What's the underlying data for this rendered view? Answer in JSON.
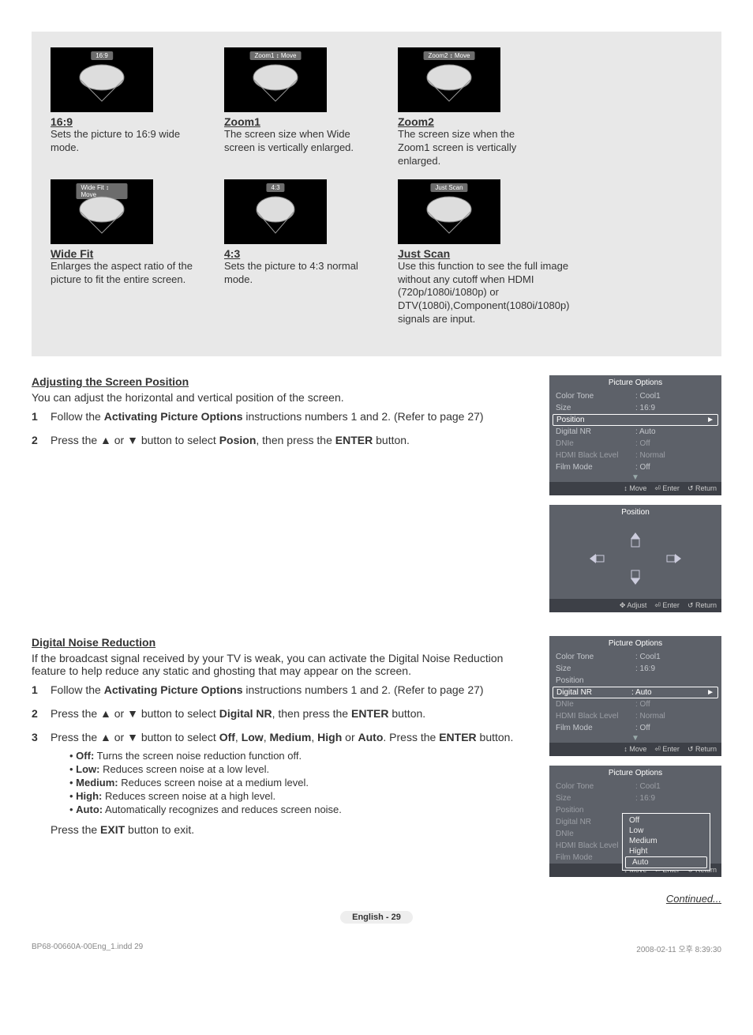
{
  "sizes": {
    "r1": [
      {
        "banner": "16:9",
        "title": "16:9",
        "desc": "Sets the picture to 16:9 wide mode."
      },
      {
        "banner": "Zoom1 ↕ Move",
        "title": "Zoom1",
        "desc": "The screen size when Wide screen is vertically enlarged."
      },
      {
        "banner": "Zoom2 ↕ Move",
        "title": "Zoom2",
        "desc": "The screen size when the Zoom1 screen is vertically enlarged."
      }
    ],
    "r2": [
      {
        "banner": "Wide Fit ↕ Move",
        "title": "Wide Fit",
        "desc": "Enlarges the aspect ratio of the picture to fit the entire screen."
      },
      {
        "banner": "4:3",
        "title": "4:3",
        "desc": "Sets the picture to 4:3 normal mode."
      },
      {
        "banner": "Just Scan",
        "title": "Just Scan",
        "desc": "Use this function to see the full image without any cutoff when HDMI (720p/1080i/1080p) or DTV(1080i),Component(1080i/1080p) signals are input."
      }
    ]
  },
  "adjust": {
    "title": "Adjusting the Screen Position",
    "intro": "You can adjust the horizontal and vertical position of the screen.",
    "step1_pre": "Follow the ",
    "step1_bold": "Activating Picture Options",
    "step1_post": " instructions numbers 1 and 2. (Refer to page 27)",
    "step2_pre": "Press the ▲ or ▼ button to select ",
    "step2_bold": "Posion",
    "step2_mid": ", then press the ",
    "step2_bold2": "ENTER",
    "step2_post": " button."
  },
  "noise": {
    "title": "Digital Noise Reduction",
    "intro": "If the broadcast signal received by your TV is weak, you can activate the Digital Noise Reduction feature to help reduce any static and ghosting that may appear on the screen.",
    "s1_pre": "Follow the ",
    "s1_b": "Activating Picture Options",
    "s1_post": " instructions numbers 1 and 2. (Refer to page 27)",
    "s2_pre": "Press the ▲ or ▼ button to select ",
    "s2_b": "Digital NR",
    "s2_mid": ", then press the ",
    "s2_b2": "ENTER",
    "s2_post": " button.",
    "s3": "Press the ▲ or ▼ button to select Off, Low, Medium, High or Auto. Press the ENTER button.",
    "bullets": {
      "off": "Turns the screen noise reduction function off.",
      "low": "Reduces screen noise at a low level.",
      "med": "Reduces screen noise at a medium level.",
      "high": "Reduces screen noise at a high level.",
      "auto": "Automatically recognizes and reduces screen noise."
    },
    "exit_pre": "Press the ",
    "exit_b": "EXIT",
    "exit_post": " button to exit."
  },
  "osd": {
    "menu_title": "Picture Options",
    "items": [
      {
        "l": "Color Tone",
        "v": ": Cool1"
      },
      {
        "l": "Size",
        "v": ": 16:9"
      },
      {
        "l": "Position",
        "v": ""
      },
      {
        "l": "Digital NR",
        "v": ": Auto"
      },
      {
        "l": "DNIe",
        "v": ": Off"
      },
      {
        "l": "HDMI Black Level",
        "v": ": Normal"
      },
      {
        "l": "Film Mode",
        "v": ": Off"
      }
    ],
    "footer": {
      "move": "Move",
      "enter": "Enter",
      "return": "Return",
      "adjust": "Adjust"
    },
    "pos_title": "Position",
    "submenu": [
      "Off",
      "Low",
      "Medium",
      "Hight",
      "Auto"
    ]
  },
  "continued": "Continued...",
  "page_label": "English - 29",
  "footer": {
    "file": "BP68-00660A-00Eng_1.indd   29",
    "stamp": "2008-02-11   오후 8:39:30"
  }
}
